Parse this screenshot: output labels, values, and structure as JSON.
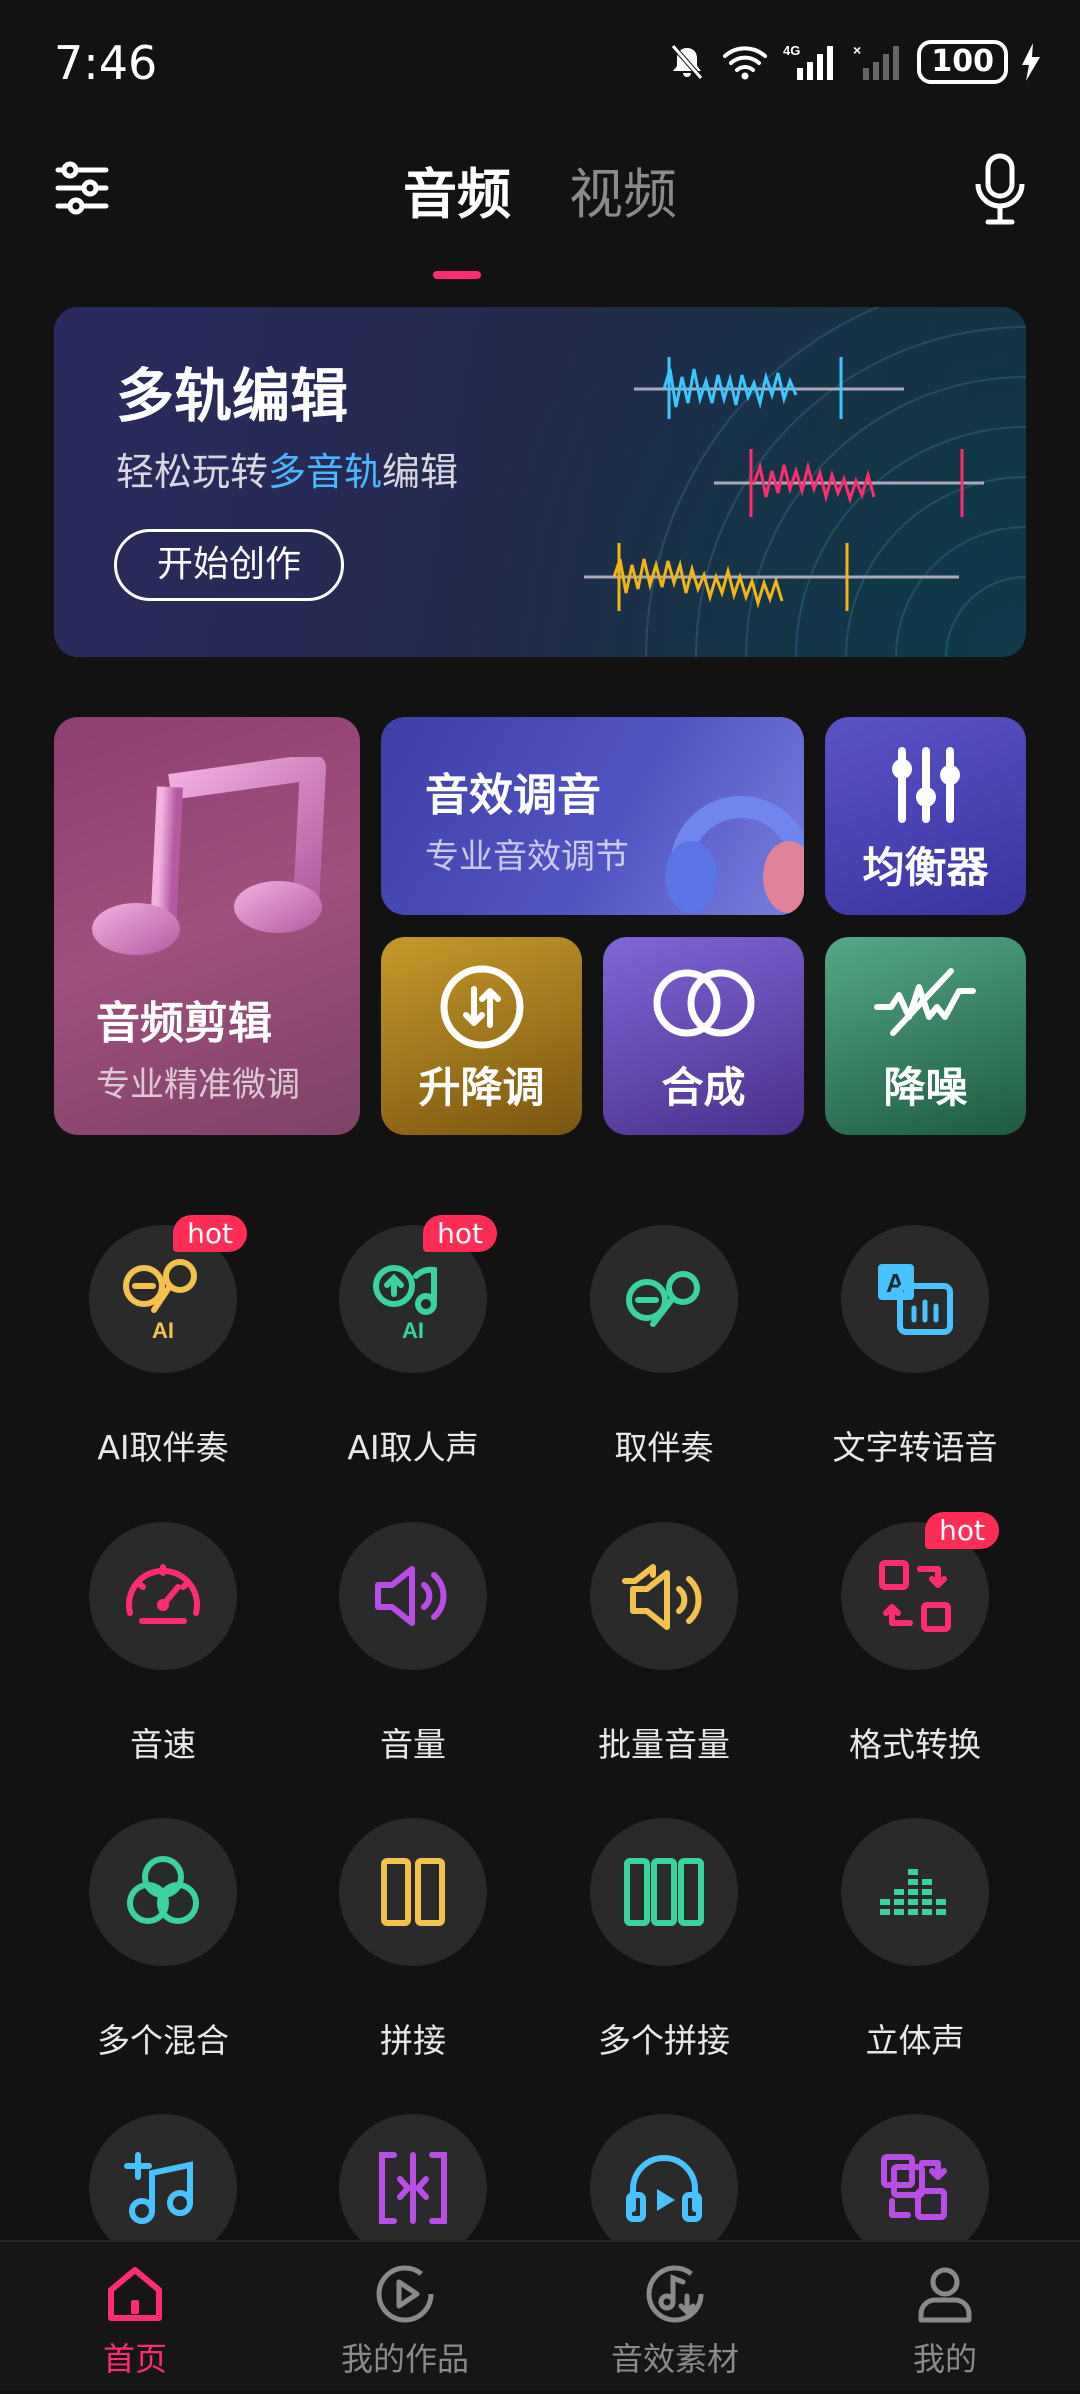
{
  "status_bar": {
    "time": "7:46",
    "battery": "100"
  },
  "header": {
    "tabs": [
      {
        "label": "音频"
      },
      {
        "label": "视频"
      }
    ]
  },
  "banner": {
    "title": "多轨编辑",
    "subtitle_pre": "轻松玩转",
    "subtitle_highlight": "多音轨",
    "subtitle_post": "编辑",
    "button": "开始创作"
  },
  "features": {
    "edit": {
      "title": "音频剪辑",
      "subtitle": "专业精准微调"
    },
    "tune": {
      "title": "音效调音",
      "subtitle": "专业音效调节"
    },
    "eq": {
      "title": "均衡器"
    },
    "pitch": {
      "title": "升降调"
    },
    "mix": {
      "title": "合成"
    },
    "denoise": {
      "title": "降噪"
    }
  },
  "tools": [
    {
      "label": "AI取伴奏",
      "hot": "hot",
      "icon": "mic-ai-icon",
      "color": "#f2c14e"
    },
    {
      "label": "AI取人声",
      "hot": "hot",
      "icon": "voice-ai-icon",
      "color": "#3ad39e"
    },
    {
      "label": "取伴奏",
      "icon": "mic-icon",
      "color": "#3ad39e"
    },
    {
      "label": "文字转语音",
      "icon": "text-to-speech-icon",
      "color": "#49c3ff"
    },
    {
      "label": "音速",
      "icon": "speedometer-icon",
      "color": "#ff2d6f"
    },
    {
      "label": "音量",
      "icon": "volume-icon",
      "color": "#b84ee6"
    },
    {
      "label": "批量音量",
      "icon": "batch-volume-icon",
      "color": "#f2c14e"
    },
    {
      "label": "格式转换",
      "hot": "hot",
      "icon": "format-convert-icon",
      "color": "#ff2d6f"
    },
    {
      "label": "多个混合",
      "icon": "mix-circles-icon",
      "color": "#3ad39e"
    },
    {
      "label": "拼接",
      "icon": "join-icon",
      "color": "#f2c14e"
    },
    {
      "label": "多个拼接",
      "icon": "multi-join-icon",
      "color": "#3ad39e"
    },
    {
      "label": "立体声",
      "icon": "stereo-bars-icon",
      "color": "#3ad39e"
    }
  ],
  "bottom_nav": [
    {
      "label": "首页"
    },
    {
      "label": "我的作品"
    },
    {
      "label": "音效素材"
    },
    {
      "label": "我的"
    }
  ],
  "colors": {
    "accent": "#ff2d6f",
    "cyan": "#49c3ff",
    "yellow": "#f2c14e",
    "green": "#3ad39e",
    "purple": "#b84ee6"
  }
}
